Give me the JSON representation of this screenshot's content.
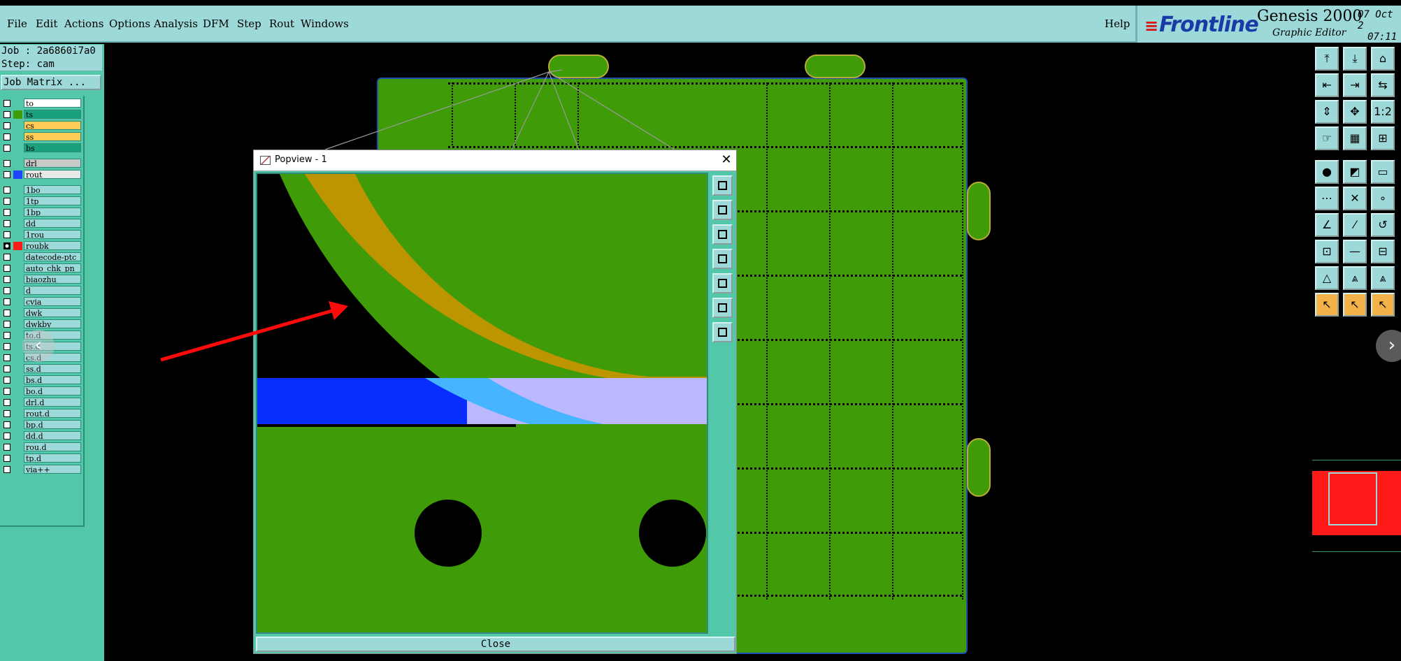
{
  "menubar": {
    "items": [
      "File",
      "Edit",
      "Actions",
      "Options",
      "Analysis",
      "DFM",
      "Step",
      "Rout",
      "Windows"
    ],
    "help": "Help"
  },
  "brand": {
    "logo": "Frontline",
    "title": "Genesis 2000",
    "subtitle": "Graphic Editor",
    "date": "07 Oct 2",
    "time": "07:11"
  },
  "job": {
    "job_line": "Job : 2a6860i7a0",
    "step_line": "Step: cam",
    "matrix_button": "Job Matrix ..."
  },
  "layers": [
    {
      "name": "to",
      "color": "#ffffff",
      "swatch": "#52c8a9",
      "checked": false
    },
    {
      "name": "ts",
      "color": "#1aa07a",
      "swatch": "#3f9b08",
      "checked": false
    },
    {
      "name": "cs",
      "color": "#ffcc55",
      "swatch": "#52c8a9",
      "checked": false
    },
    {
      "name": "ss",
      "color": "#ffcc55",
      "swatch": "#52c8a9",
      "checked": false
    },
    {
      "name": "bs",
      "color": "#1aa07a",
      "swatch": "#52c8a9",
      "checked": false
    },
    {
      "name": "drl",
      "color": "#c8c8c8",
      "swatch": "#52c8a9",
      "checked": false
    },
    {
      "name": "rout",
      "color": "#e8e8e8",
      "swatch": "#1e46ff",
      "checked": false
    },
    {
      "name": "1bo",
      "color": "#9cd9d8",
      "swatch": "#52c8a9",
      "checked": false
    },
    {
      "name": "1tp",
      "color": "#9cd9d8",
      "swatch": "#52c8a9",
      "checked": false
    },
    {
      "name": "1bp",
      "color": "#9cd9d8",
      "swatch": "#52c8a9",
      "checked": false
    },
    {
      "name": "dd",
      "color": "#9cd9d8",
      "swatch": "#52c8a9",
      "checked": false
    },
    {
      "name": "1rou",
      "color": "#9cd9d8",
      "swatch": "#52c8a9",
      "checked": false
    },
    {
      "name": "roubk",
      "color": "#9cd9d8",
      "swatch": "#ff1a1a",
      "checked": true
    },
    {
      "name": "datecode-ptc",
      "color": "#9cd9d8",
      "swatch": "#52c8a9",
      "checked": false
    },
    {
      "name": "auto_chk_pn",
      "color": "#9cd9d8",
      "swatch": "#52c8a9",
      "checked": false
    },
    {
      "name": "biaozhu",
      "color": "#9cd9d8",
      "swatch": "#52c8a9",
      "checked": false
    },
    {
      "name": "d",
      "color": "#9cd9d8",
      "swatch": "#52c8a9",
      "checked": false
    },
    {
      "name": "cvia",
      "color": "#9cd9d8",
      "swatch": "#52c8a9",
      "checked": false
    },
    {
      "name": "dwk",
      "color": "#9cd9d8",
      "swatch": "#52c8a9",
      "checked": false
    },
    {
      "name": "dwkby",
      "color": "#9cd9d8",
      "swatch": "#52c8a9",
      "checked": false
    },
    {
      "name": "to.d",
      "color": "#9cd9d8",
      "swatch": "#52c8a9",
      "checked": false
    },
    {
      "name": "ts.d",
      "color": "#9cd9d8",
      "swatch": "#52c8a9",
      "checked": false
    },
    {
      "name": "cs.d",
      "color": "#9cd9d8",
      "swatch": "#52c8a9",
      "checked": false
    },
    {
      "name": "ss.d",
      "color": "#9cd9d8",
      "swatch": "#52c8a9",
      "checked": false
    },
    {
      "name": "bs.d",
      "color": "#9cd9d8",
      "swatch": "#52c8a9",
      "checked": false
    },
    {
      "name": "bo.d",
      "color": "#9cd9d8",
      "swatch": "#52c8a9",
      "checked": false
    },
    {
      "name": "drl.d",
      "color": "#9cd9d8",
      "swatch": "#52c8a9",
      "checked": false
    },
    {
      "name": "rout.d",
      "color": "#9cd9d8",
      "swatch": "#52c8a9",
      "checked": false
    },
    {
      "name": "bp.d",
      "color": "#9cd9d8",
      "swatch": "#52c8a9",
      "checked": false
    },
    {
      "name": "dd.d",
      "color": "#9cd9d8",
      "swatch": "#52c8a9",
      "checked": false
    },
    {
      "name": "rou.d",
      "color": "#9cd9d8",
      "swatch": "#52c8a9",
      "checked": false
    },
    {
      "name": "tp.d",
      "color": "#9cd9d8",
      "swatch": "#52c8a9",
      "checked": false
    },
    {
      "name": "via++",
      "color": "#9cd9d8",
      "swatch": "#52c8a9",
      "checked": false
    }
  ],
  "popview": {
    "title": "Popview - 1",
    "close_x": "✕",
    "close_button": "Close"
  },
  "nav": {
    "prev": "‹",
    "next": "›"
  },
  "colors": {
    "board_green": "#3f9b08",
    "gold_arc": "#bc9500",
    "blue_bar": "#0a2dff",
    "light_purple": "#bbb8ff",
    "cyan_overlap": "#46b4ff",
    "arrow_red": "#ff0a0a",
    "panel_teal": "#52c8a9",
    "menu_cyan": "#9cd9d8"
  }
}
